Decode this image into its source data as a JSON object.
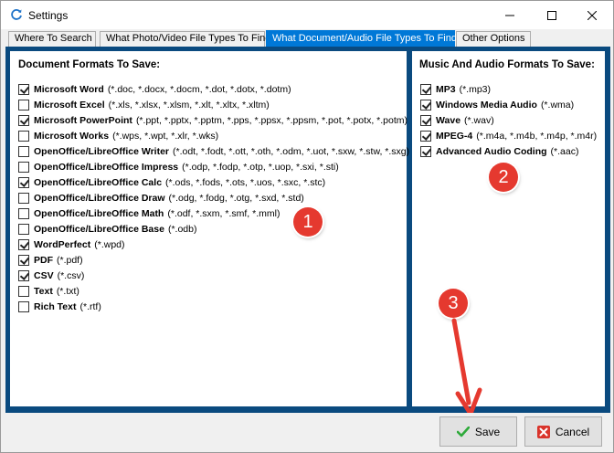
{
  "window": {
    "title": "Settings",
    "icon": "refresh-icon"
  },
  "tabs": [
    {
      "label": "Where To Search",
      "active": false
    },
    {
      "label": "What Photo/Video File Types To Find",
      "active": false
    },
    {
      "label": "What Document/Audio File Types To Find",
      "active": true
    },
    {
      "label": "Other Options",
      "active": false
    }
  ],
  "documents": {
    "header": "Document Formats To Save:",
    "items": [
      {
        "name": "Microsoft Word",
        "ext": "(*.doc, *.docx, *.docm, *.dot, *.dotx, *.dotm)",
        "checked": true
      },
      {
        "name": "Microsoft Excel",
        "ext": "(*.xls, *.xlsx, *.xlsm, *.xlt, *.xltx, *.xltm)",
        "checked": false
      },
      {
        "name": "Microsoft PowerPoint",
        "ext": "(*.ppt, *.pptx, *.pptm, *.pps, *.ppsx, *.ppsm, *.pot, *.potx, *.potm)",
        "checked": true
      },
      {
        "name": "Microsoft Works",
        "ext": "(*.wps, *.wpt, *.xlr, *.wks)",
        "checked": false
      },
      {
        "name": "OpenOffice/LibreOffice Writer",
        "ext": "(*.odt, *.fodt, *.ott, *.oth, *.odm, *.uot, *.sxw, *.stw, *.sxg)",
        "checked": false
      },
      {
        "name": "OpenOffice/LibreOffice Impress",
        "ext": "(*.odp, *.fodp, *.otp, *.uop, *.sxi, *.sti)",
        "checked": false
      },
      {
        "name": "OpenOffice/LibreOffice Calc",
        "ext": "(*.ods, *.fods, *.ots, *.uos, *.sxc, *.stc)",
        "checked": true
      },
      {
        "name": "OpenOffice/LibreOffice Draw",
        "ext": "(*.odg, *.fodg, *.otg, *.sxd, *.std)",
        "checked": false
      },
      {
        "name": "OpenOffice/LibreOffice Math",
        "ext": "(*.odf, *.sxm, *.smf, *.mml)",
        "checked": false
      },
      {
        "name": "OpenOffice/LibreOffice Base",
        "ext": "(*.odb)",
        "checked": false
      },
      {
        "name": "WordPerfect",
        "ext": "(*.wpd)",
        "checked": true
      },
      {
        "name": "PDF",
        "ext": "(*.pdf)",
        "checked": true
      },
      {
        "name": "CSV",
        "ext": "(*.csv)",
        "checked": true
      },
      {
        "name": "Text",
        "ext": "(*.txt)",
        "checked": false
      },
      {
        "name": "Rich Text",
        "ext": "(*.rtf)",
        "checked": false
      }
    ]
  },
  "audio": {
    "header": "Music And Audio Formats To Save:",
    "items": [
      {
        "name": "MP3",
        "ext": "(*.mp3)",
        "checked": true
      },
      {
        "name": "Windows Media Audio",
        "ext": "(*.wma)",
        "checked": true
      },
      {
        "name": "Wave",
        "ext": "(*.wav)",
        "checked": true
      },
      {
        "name": "MPEG-4",
        "ext": "(*.m4a, *.m4b, *.m4p, *.m4r)",
        "checked": true
      },
      {
        "name": "Advanced Audio Coding",
        "ext": "(*.aac)",
        "checked": true
      }
    ]
  },
  "badges": {
    "one": "1",
    "two": "2",
    "three": "3",
    "color": "#e5392f"
  },
  "buttons": {
    "save_label": "Save",
    "save_icon": "checkmark-icon",
    "cancel_label": "Cancel",
    "cancel_icon": "x-icon"
  },
  "colors": {
    "accent": "#0078d7",
    "panel_border": "#0a4a7f",
    "arrow": "#e5392f"
  }
}
